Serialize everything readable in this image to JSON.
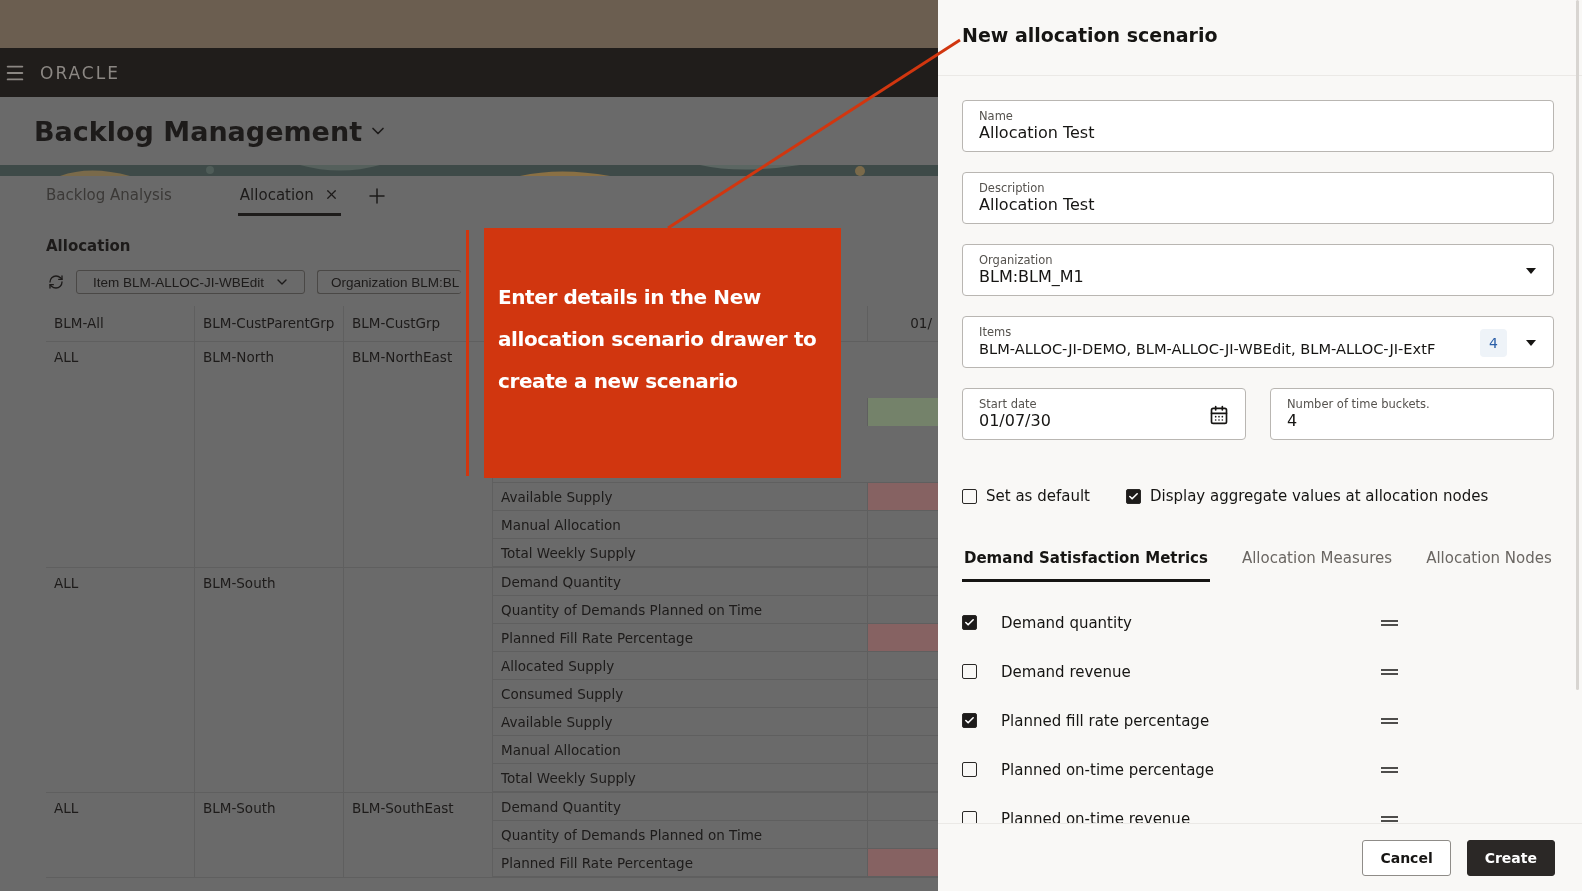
{
  "top_bar": {
    "logo": "ORACLE"
  },
  "page": {
    "title": "Backlog Management"
  },
  "tabs": [
    {
      "label": "Backlog Analysis",
      "selected": false,
      "closable": false
    },
    {
      "label": "Allocation",
      "selected": true,
      "closable": true
    }
  ],
  "section": {
    "title": "Allocation"
  },
  "filters": [
    {
      "label": "Item BLM-ALLOC-JI-WBEdit",
      "dropdown": true
    },
    {
      "label": "Organization BLM:BL",
      "dropdown": false
    }
  ],
  "table": {
    "columns": [
      "BLM-All",
      "BLM-CustParentGrp",
      "BLM-CustGrp"
    ],
    "date_column": "01/",
    "groups": [
      {
        "level1": "ALL",
        "level2": "BLM-North",
        "level3": "BLM-NorthEast",
        "covered_cells": [
          {
            "color": "#74826a"
          }
        ],
        "measures": [
          {
            "label": "Available Supply",
            "color": "#866262"
          },
          {
            "label": "Manual Allocation"
          },
          {
            "label": "Total Weekly Supply"
          }
        ]
      },
      {
        "level1": "ALL",
        "level2": "BLM-South",
        "measures": [
          {
            "label": "Demand Quantity"
          },
          {
            "label": "Quantity of Demands Planned on Time"
          },
          {
            "label": "Planned Fill Rate Percentage",
            "color": "#866262"
          },
          {
            "label": "Allocated Supply"
          },
          {
            "label": "Consumed Supply"
          },
          {
            "label": "Available Supply"
          },
          {
            "label": "Manual Allocation"
          },
          {
            "label": "Total Weekly Supply"
          }
        ]
      },
      {
        "level1": "ALL",
        "level2": "BLM-South",
        "level3": "BLM-SouthEast",
        "measures": [
          {
            "label": "Demand Quantity"
          },
          {
            "label": "Quantity of Demands Planned on Time"
          },
          {
            "label": "Planned Fill Rate Percentage",
            "color": "#866262"
          }
        ]
      }
    ]
  },
  "callout": {
    "text": "Enter details in the New allocation scenario drawer to create a new scenario"
  },
  "drawer": {
    "title": "New allocation scenario",
    "fields": [
      {
        "kind": "text",
        "label": "Name",
        "value": "Allocation Test"
      },
      {
        "kind": "text",
        "label": "Description",
        "value": "Allocation Test"
      },
      {
        "kind": "select",
        "label": "Organization",
        "value": "BLM:BLM_M1"
      },
      {
        "kind": "multiselect",
        "label": "Items",
        "value": "BLM-ALLOC-JI-DEMO, BLM-ALLOC-JI-WBEdit, BLM-ALLOC-JI-ExtF",
        "count": "4"
      }
    ],
    "pair_fields": [
      {
        "kind": "date",
        "label": "Start date",
        "value": "01/07/30"
      },
      {
        "kind": "text",
        "label": "Number of time buckets.",
        "value": "4"
      }
    ],
    "options": [
      {
        "label": "Set as default",
        "checked": false
      },
      {
        "label": "Display aggregate values at allocation nodes",
        "checked": true
      }
    ],
    "tabs": [
      {
        "label": "Demand Satisfaction Metrics",
        "selected": true
      },
      {
        "label": "Allocation Measures",
        "selected": false
      },
      {
        "label": "Allocation Nodes",
        "selected": false
      }
    ],
    "metrics": [
      {
        "label": "Demand quantity",
        "checked": true
      },
      {
        "label": "Demand revenue",
        "checked": false
      },
      {
        "label": "Planned fill rate percentage",
        "checked": true
      },
      {
        "label": "Planned on-time percentage",
        "checked": false
      },
      {
        "label": "Planned on-time revenue",
        "checked": false
      }
    ],
    "buttons": [
      {
        "label": "Cancel",
        "kind": "secondary"
      },
      {
        "label": "Create",
        "kind": "primary"
      }
    ]
  }
}
